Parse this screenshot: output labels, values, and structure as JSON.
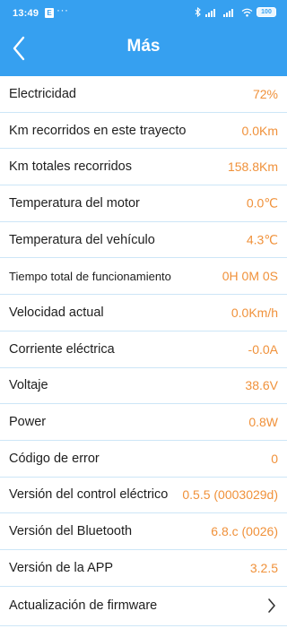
{
  "status_bar": {
    "time": "13:49",
    "notification_badge": "E",
    "dots": "···",
    "battery": "100",
    "battery_level": 1.0
  },
  "header": {
    "title": "Más",
    "back_icon": "chevron-left-icon",
    "background": "#36a0f0"
  },
  "accent_color": "#f0913a",
  "rows": [
    {
      "label": "Electricidad",
      "value": "72%"
    },
    {
      "label": "Km recorridos en este trayecto",
      "value": "0.0Km"
    },
    {
      "label": "Km totales recorridos",
      "value": "158.8Km"
    },
    {
      "label": "Temperatura del motor",
      "value": "0.0℃"
    },
    {
      "label": "Temperatura del vehículo",
      "value": "4.3℃"
    },
    {
      "label": "Tiempo total de funcionamiento",
      "value": "0H 0M 0S"
    },
    {
      "label": "Velocidad actual",
      "value": "0.0Km/h"
    },
    {
      "label": "Corriente eléctrica",
      "value": "-0.0A"
    },
    {
      "label": "Voltaje",
      "value": "38.6V"
    },
    {
      "label": "Power",
      "value": "0.8W"
    },
    {
      "label": "Código de error",
      "value": "0"
    },
    {
      "label": "Versión del control eléctrico",
      "value": "0.5.5 (0003029d)"
    },
    {
      "label": "Versión del Bluetooth",
      "value": "6.8.c (0026)"
    },
    {
      "label": "Versión de la APP",
      "value": "3.2.5"
    }
  ],
  "firmware": {
    "label": "Actualización de firmware",
    "icon": "chevron-right-icon"
  }
}
